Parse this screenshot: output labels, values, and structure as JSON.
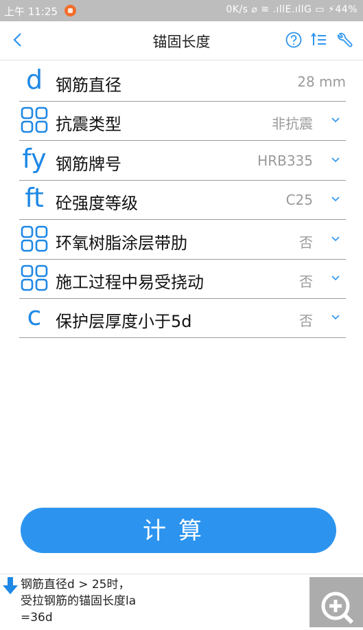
{
  "status": {
    "time": "上午 11:25",
    "right": "0K/s ⌀ ≋ .ıllE.ıllG ▭ ⚡44%"
  },
  "appbar": {
    "title": "锚固长度",
    "icons": [
      "back-icon",
      "help-icon",
      "list-icon",
      "wrench-icon"
    ]
  },
  "rows": [
    {
      "symbol": "d",
      "label": "钢筋直径",
      "value": "28 mm"
    },
    {
      "symbol": "",
      "label": "抗震类型",
      "value": "非抗震"
    },
    {
      "symbol": "fy",
      "label": "钢筋牌号",
      "value": "HRB335"
    },
    {
      "symbol": "ft",
      "label": "砼强度等级",
      "value": "C25"
    },
    {
      "symbol": "",
      "label": "环氧树脂涂层带肋",
      "value": "否"
    },
    {
      "symbol": "",
      "label": "施工过程中易受挠动",
      "value": "否"
    },
    {
      "symbol": "c",
      "label": "保护层厚度小于5d",
      "value": "否"
    }
  ],
  "calc_label": "计算",
  "hint": {
    "text": "钢筋直径d > 25时，\n受拉钢筋的锚固长度la\n=36d"
  },
  "colors": {
    "accent": "#2c94ef",
    "symbol": "#1e88e5",
    "statusbar": "#bdbdbd"
  }
}
